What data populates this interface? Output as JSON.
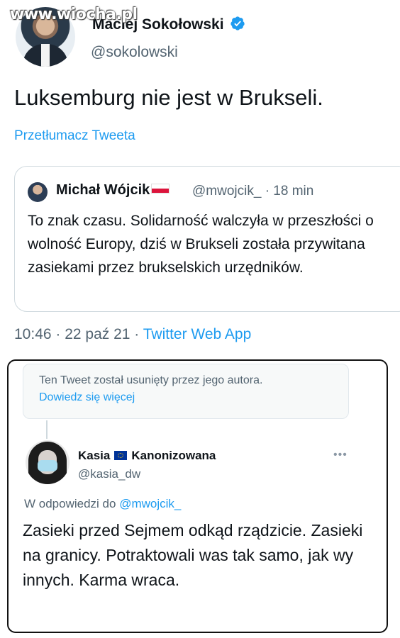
{
  "watermark": "www.wiocha.pl",
  "main_tweet": {
    "author_name": "Maciej Sokołowski",
    "handle": "@sokolowski",
    "text": "Luksemburg nie jest w Brukseli.",
    "translate_label": "Przetłumacz Tweeta",
    "timestamp": "10:46 · 22 paź 21 · ",
    "source_app": "Twitter Web App"
  },
  "quoted_tweet": {
    "author_name": "Michał Wójcik",
    "meta": "@mwojcik_ · 18 min",
    "text": "To znak czasu. Solidarność walczyła w przeszłości o wolność Europy, dziś w Brukseli została przywitana zasiekami przez brukselskich urzędników."
  },
  "reply_card": {
    "deleted_notice": "Ten Tweet został usunięty przez jego autora.",
    "learn_more": "Dowiedz się więcej",
    "reply_author_first": "Kasia",
    "reply_author_last": "Kanonizowana",
    "reply_handle": "@kasia_dw",
    "replying_prefix": "W odpowiedzi do ",
    "replying_to": "@mwojcik_",
    "reply_text": "Zasieki przed Sejmem odkąd rządzicie. Zasieki na granicy. Potraktowali was tak samo, jak wy innych. Karma wraca."
  },
  "colors": {
    "accent": "#1d9bf0",
    "secondary_text": "#536471",
    "primary_text": "#0f1419"
  }
}
